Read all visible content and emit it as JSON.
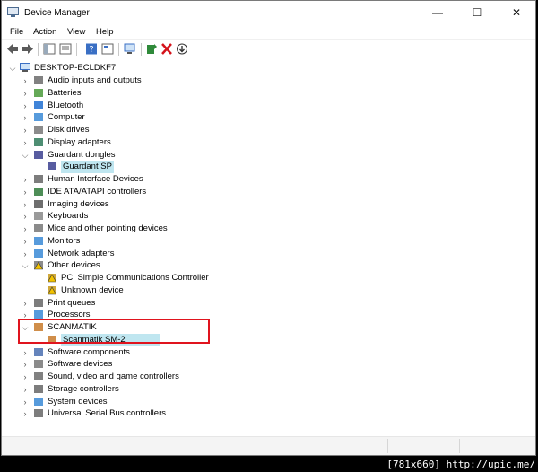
{
  "window": {
    "title": "Device Manager",
    "controls": {
      "minimize": "—",
      "maximize": "☐",
      "close": "✕"
    }
  },
  "menu": [
    "File",
    "Action",
    "View",
    "Help"
  ],
  "tree": {
    "root": "DESKTOP-ECLDKF7",
    "items": [
      {
        "label": "Audio inputs and outputs",
        "icon": "speaker-icon",
        "expanded": false
      },
      {
        "label": "Batteries",
        "icon": "battery-icon",
        "expanded": false
      },
      {
        "label": "Bluetooth",
        "icon": "bluetooth-icon",
        "expanded": false
      },
      {
        "label": "Computer",
        "icon": "monitor-icon",
        "expanded": false
      },
      {
        "label": "Disk drives",
        "icon": "disk-icon",
        "expanded": false
      },
      {
        "label": "Display adapters",
        "icon": "display-adapter-icon",
        "expanded": false
      },
      {
        "label": "Guardant dongles",
        "icon": "dongle-icon",
        "expanded": true
      },
      {
        "label": "Guardant SP",
        "icon": "dongle-icon",
        "child": true,
        "selected": true
      },
      {
        "label": "Human Interface Devices",
        "icon": "hid-icon",
        "expanded": false
      },
      {
        "label": "IDE ATA/ATAPI controllers",
        "icon": "ide-icon",
        "expanded": false
      },
      {
        "label": "Imaging devices",
        "icon": "camera-icon",
        "expanded": false
      },
      {
        "label": "Keyboards",
        "icon": "keyboard-icon",
        "expanded": false
      },
      {
        "label": "Mice and other pointing devices",
        "icon": "mouse-icon",
        "expanded": false
      },
      {
        "label": "Monitors",
        "icon": "monitor-icon",
        "expanded": false
      },
      {
        "label": "Network adapters",
        "icon": "network-icon",
        "expanded": false
      },
      {
        "label": "Other devices",
        "icon": "unknown-device-icon",
        "expanded": true
      },
      {
        "label": "PCI Simple Communications Controller",
        "icon": "warning-device-icon",
        "child": true
      },
      {
        "label": "Unknown device",
        "icon": "warning-device-icon",
        "child": true
      },
      {
        "label": "Print queues",
        "icon": "printer-icon",
        "expanded": false
      },
      {
        "label": "Processors",
        "icon": "processor-icon",
        "expanded": false
      },
      {
        "label": "SCANMATIK",
        "icon": "scanmatik-icon",
        "expanded": true
      },
      {
        "label": "Scanmatik SM-2",
        "icon": "scanmatik-icon",
        "child": true,
        "selected": true
      },
      {
        "label": "Software components",
        "icon": "software-component-icon",
        "expanded": false
      },
      {
        "label": "Software devices",
        "icon": "software-device-icon",
        "expanded": false
      },
      {
        "label": "Sound, video and game controllers",
        "icon": "speaker-icon",
        "expanded": false
      },
      {
        "label": "Storage controllers",
        "icon": "storage-icon",
        "expanded": false
      },
      {
        "label": "System devices",
        "icon": "system-icon",
        "expanded": false
      },
      {
        "label": "Universal Serial Bus controllers",
        "icon": "usb-icon",
        "expanded": false
      }
    ]
  },
  "watermark": "[781x660] http://upic.me/",
  "colors": {
    "selection": "#bfe6f0",
    "highlight_border": "#e0141e"
  }
}
